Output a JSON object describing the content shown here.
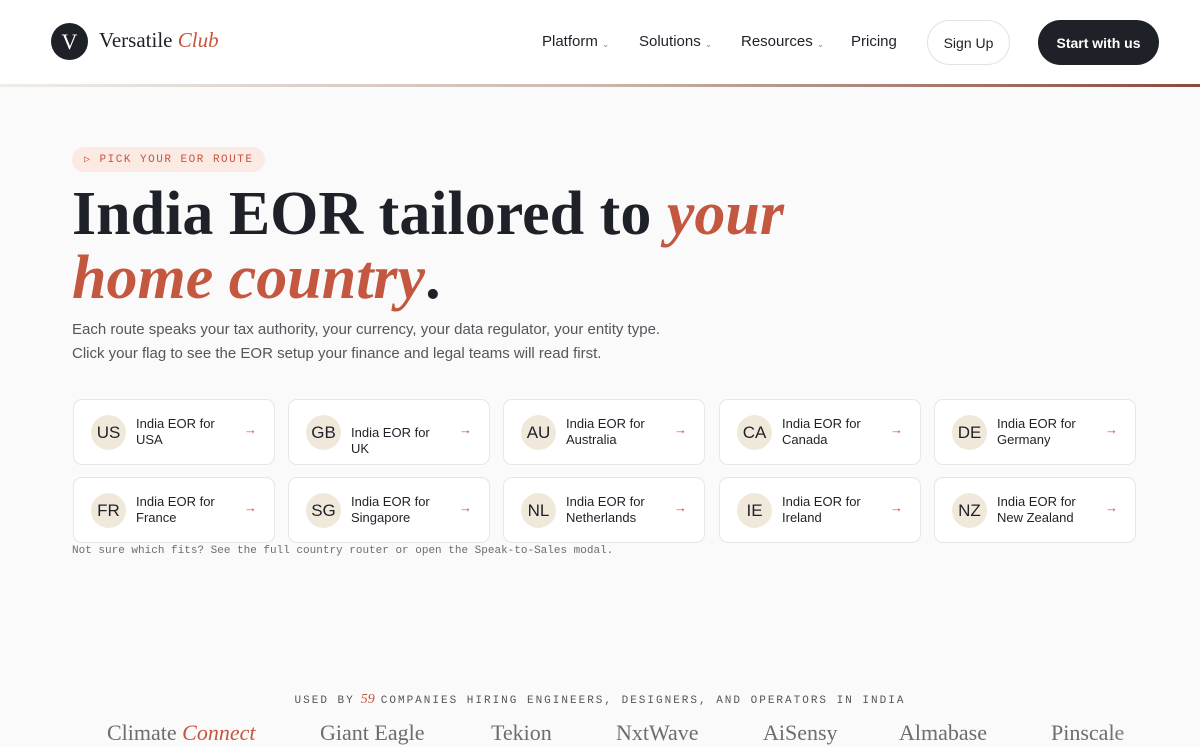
{
  "brand": {
    "mark": "V",
    "name": "Versatile",
    "name_accent": "Club"
  },
  "nav": {
    "items": [
      {
        "label": "Platform",
        "caret": "⌄"
      },
      {
        "label": "Solutions",
        "caret": "⌄"
      },
      {
        "label": "Resources",
        "caret": "⌄"
      },
      {
        "label": "Pricing",
        "caret": ""
      }
    ],
    "signup_label": "Sign Up",
    "cta_label": "Start with us"
  },
  "hero": {
    "pill_icon": "▷",
    "pill_text": "PICK YOUR EOR ROUTE",
    "headline_plain": "India EOR tailored to ",
    "headline_accent": "your home country",
    "headline_end": ".",
    "sub_line1": "Each route speaks your tax authority, your currency, your data regulator, your entity type.",
    "sub_line2": "Click your flag to see the EOR setup your finance and legal teams will read first."
  },
  "countries": [
    {
      "code": "US",
      "label": "India EOR for USA",
      "arrow": "→"
    },
    {
      "code": "GB",
      "label": "India EOR for UK",
      "arrow": "→"
    },
    {
      "code": "AU",
      "label": "India EOR for Australia",
      "arrow": "→"
    },
    {
      "code": "CA",
      "label": "India EOR for Canada",
      "arrow": "→"
    },
    {
      "code": "DE",
      "label": "India EOR for Germany",
      "arrow": "→"
    },
    {
      "code": "FR",
      "label": "India EOR for France",
      "arrow": "→"
    },
    {
      "code": "SG",
      "label": "India EOR for Singapore",
      "arrow": "→"
    },
    {
      "code": "NL",
      "label": "India EOR for Netherlands",
      "arrow": "→"
    },
    {
      "code": "IE",
      "label": "India EOR for Ireland",
      "arrow": "→"
    },
    {
      "code": "NZ",
      "label": "India EOR for New Zealand",
      "arrow": "→"
    }
  ],
  "note": "Not sure which fits? See the full country router or open the Speak-to-Sales modal.",
  "used_by": {
    "prefix": "USED BY",
    "count": "59",
    "suffix": "COMPANIES HIRING ENGINEERS, DESIGNERS, AND OPERATORS IN INDIA"
  },
  "companies": [
    {
      "name": "Climate",
      "accent": "Connect"
    },
    {
      "name": "Giant Eagle",
      "accent": ""
    },
    {
      "name": "Tekion",
      "accent": ""
    },
    {
      "name": "NxtWave",
      "accent": ""
    },
    {
      "name": "AiSensy",
      "accent": ""
    },
    {
      "name": "Almabase",
      "accent": ""
    },
    {
      "name": "Pinscale",
      "accent": ""
    }
  ],
  "colors": {
    "accent": "#c4573f",
    "dark": "#1f2128",
    "code_bg": "#f1e8dc",
    "pill_bg": "#fbe9e4"
  }
}
